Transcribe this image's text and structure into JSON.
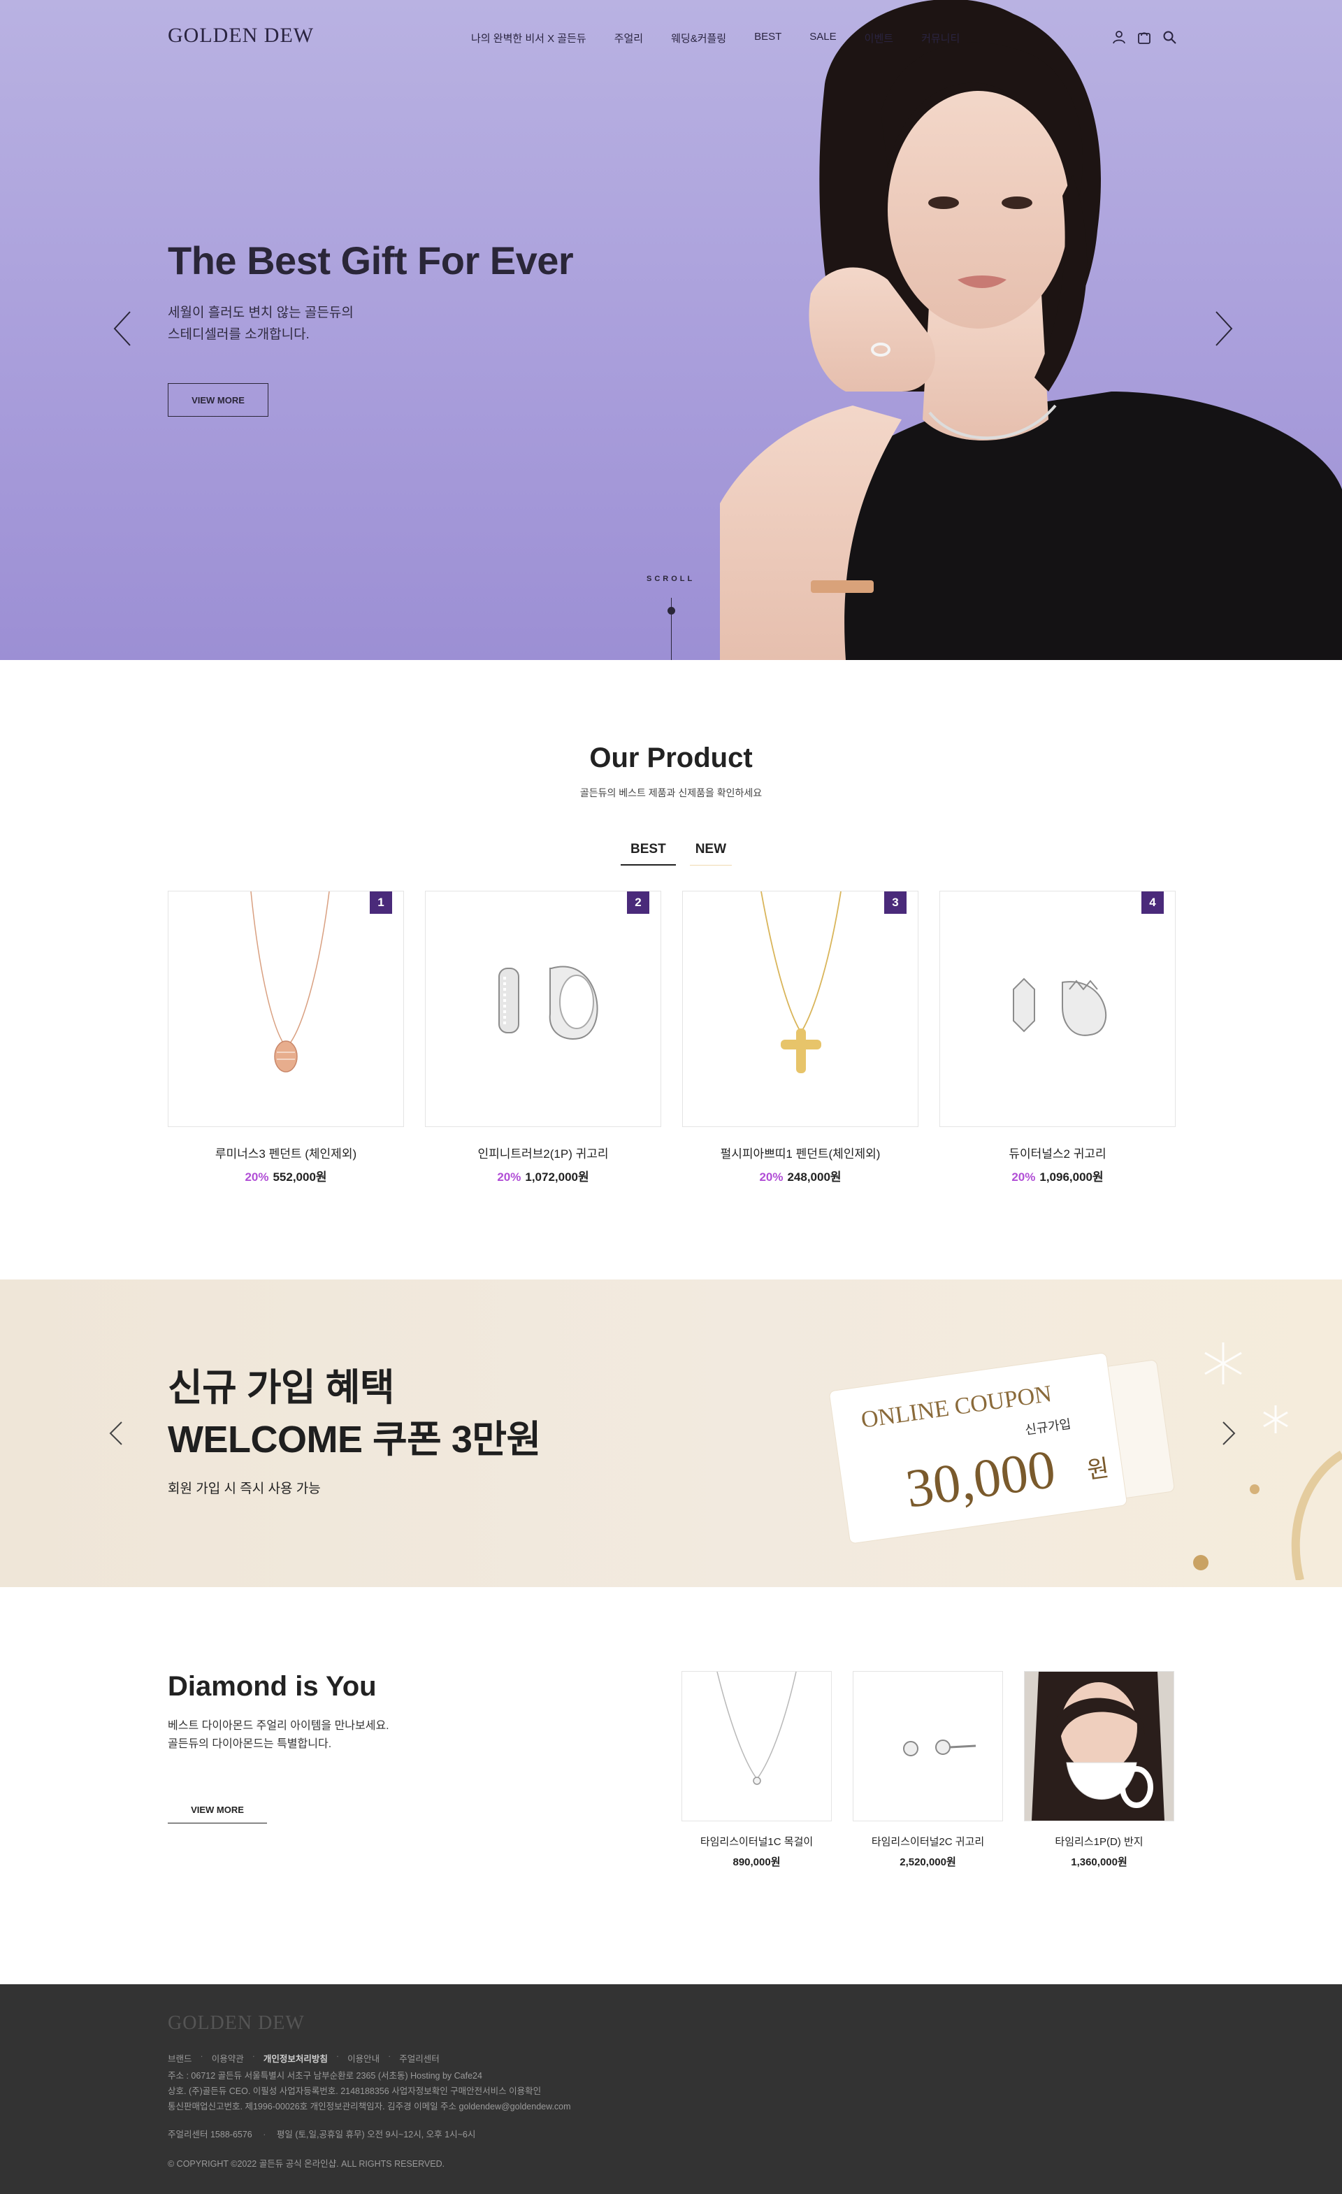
{
  "header": {
    "logo": "GOLDEN DEW",
    "nav": [
      "나의 완벽한 비서 X 골든듀",
      "주얼리",
      "웨딩&커플링",
      "BEST",
      "SALE",
      "이벤트",
      "커뮤니티"
    ],
    "icons": [
      "user-icon",
      "cart-icon",
      "search-icon"
    ]
  },
  "hero": {
    "title": "The Best Gift For Ever",
    "subtitle": "세월이 흘러도 변치 않는 골든듀의\n스테디셀러를 소개합니다.",
    "button": "VIEW MORE",
    "scroll": "SCROLL",
    "background": "#aca1dc"
  },
  "products": {
    "title": "Our Product",
    "subtitle": "골든듀의 베스트 제품과 신제품을 확인하세요",
    "tabs": [
      "BEST",
      "NEW"
    ],
    "active_tab": "BEST",
    "items": [
      {
        "rank": "1",
        "name": "루미너스3 펜던트 (체인제외)",
        "discount": "20%",
        "price": "552,000원",
        "image": "rose-gold-pendant"
      },
      {
        "rank": "2",
        "name": "인피니트러브2(1P) 귀고리",
        "discount": "20%",
        "price": "1,072,000원",
        "image": "silver-hoop-earrings"
      },
      {
        "rank": "3",
        "name": "펄시피아쁘띠1 펜던트(체인제외)",
        "discount": "20%",
        "price": "248,000원",
        "image": "gold-cross-pendant"
      },
      {
        "rank": "4",
        "name": "듀이터널스2 귀고리",
        "discount": "20%",
        "price": "1,096,000원",
        "image": "silver-crown-earrings"
      }
    ],
    "rank_color": "#4a2a7a",
    "discount_color": "#b14fd6"
  },
  "banner": {
    "title": "신규 가입 혜택\nWELCOME 쿠폰 3만원",
    "subtitle": "회원 가입 시 즉시 사용 가능",
    "coupon_heading": "ONLINE COUPON",
    "coupon_tag": "신규가입",
    "coupon_amount": "30,000",
    "coupon_unit": "원"
  },
  "diamond": {
    "title": "Diamond is You",
    "subtitle": "베스트 다이아몬드 주얼리 아이템을 만나보세요.\n골든듀의 다이아몬드는 특별합니다.",
    "button": "VIEW MORE",
    "items": [
      {
        "name": "타임리스이터널1C 목걸이",
        "price": "890,000원",
        "image": "silver-necklace"
      },
      {
        "name": "타임리스이터널2C 귀고리",
        "price": "2,520,000원",
        "image": "stud-earrings"
      },
      {
        "name": "타임리스1P(D) 반지",
        "price": "1,360,000원",
        "image": "model-ring"
      }
    ],
    "scroll_progress": 0.33
  },
  "footer": {
    "logo": "GOLDEN DEW",
    "links": [
      "브랜드",
      "이용약관",
      "개인정보처리방침",
      "이용안내",
      "주얼리센터"
    ],
    "bold_link": "개인정보처리방침",
    "line1": "주소 : 06712 골든듀 서울특별시 서초구 남부순환로 2365 (서초동)      Hosting by Cafe24",
    "line2": "상호. (주)골든듀      CEO. 이필성      사업자등록번호. 2148188356      사업자정보확인      구매안전서비스 이용확인",
    "line3": "통신판매업신고번호. 제1996-00026호      개인정보관리책임자. 김주경      이메일 주소 goldendew@goldendew.com",
    "cs": "주얼리센터 1588-6576",
    "hours": "평일 (토,일,공휴일 휴무) 오전 9시~12시, 오후 1시~6시",
    "copyright": "© COPYRIGHT ©2022 골든듀 공식 온라인샵. ALL RIGHTS RESERVED."
  }
}
